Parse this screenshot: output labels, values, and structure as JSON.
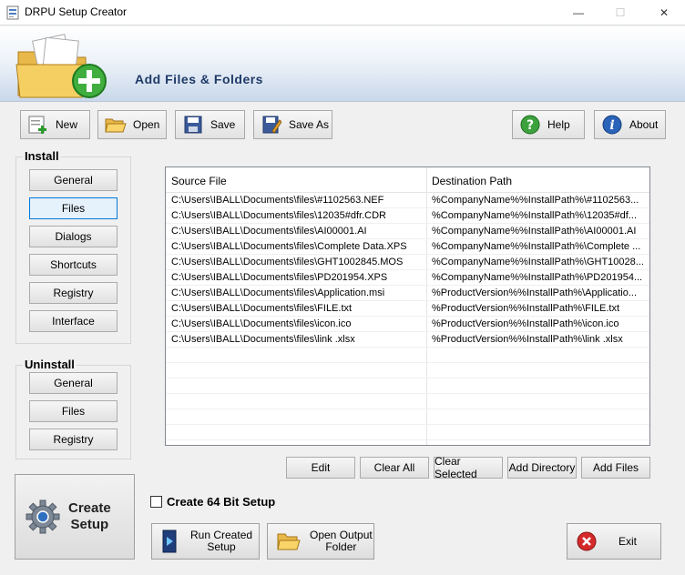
{
  "window": {
    "title": "DRPU Setup Creator"
  },
  "header": {
    "title": "Add Files & Folders"
  },
  "toolbar": {
    "new_label": "New",
    "open_label": "Open",
    "save_label": "Save",
    "save_as_label": "Save As",
    "help_label": "Help",
    "about_label": "About"
  },
  "install": {
    "title": "Install",
    "items": [
      "General",
      "Files",
      "Dialogs",
      "Shortcuts",
      "Registry",
      "Interface"
    ]
  },
  "uninstall": {
    "title": "Uninstall",
    "items": [
      "General",
      "Files",
      "Registry"
    ]
  },
  "table": {
    "headers": [
      "Source File",
      "Destination Path"
    ],
    "rows": [
      [
        "C:\\Users\\IBALL\\Documents\\files\\#1102563.NEF",
        "%CompanyName%%InstallPath%\\#1102563..."
      ],
      [
        "C:\\Users\\IBALL\\Documents\\files\\12035#dfr.CDR",
        "%CompanyName%%InstallPath%\\12035#df..."
      ],
      [
        "C:\\Users\\IBALL\\Documents\\files\\AI00001.AI",
        "%CompanyName%%InstallPath%\\AI00001.AI"
      ],
      [
        "C:\\Users\\IBALL\\Documents\\files\\Complete Data.XPS",
        "%CompanyName%%InstallPath%\\Complete ..."
      ],
      [
        "C:\\Users\\IBALL\\Documents\\files\\GHT1002845.MOS",
        "%CompanyName%%InstallPath%\\GHT10028..."
      ],
      [
        "C:\\Users\\IBALL\\Documents\\files\\PD201954.XPS",
        "%CompanyName%%InstallPath%\\PD201954..."
      ],
      [
        "C:\\Users\\IBALL\\Documents\\files\\Application.msi",
        "%ProductVersion%%InstallPath%\\Applicatio..."
      ],
      [
        "C:\\Users\\IBALL\\Documents\\files\\FILE.txt",
        "%ProductVersion%%InstallPath%\\FILE.txt"
      ],
      [
        "C:\\Users\\IBALL\\Documents\\files\\icon.ico",
        "%ProductVersion%%InstallPath%\\icon.ico"
      ],
      [
        "C:\\Users\\IBALL\\Documents\\files\\link .xlsx",
        "%ProductVersion%%InstallPath%\\link .xlsx"
      ]
    ]
  },
  "actions": {
    "edit": "Edit",
    "clear_all": "Clear All",
    "clear_selected": "Clear Selected",
    "add_directory": "Add Directory",
    "add_files": "Add Files"
  },
  "option": {
    "create_64bit": "Create 64 Bit Setup",
    "checked": false
  },
  "bottom": {
    "create_line1": "Create",
    "create_line2": "Setup",
    "run_line1": "Run Created",
    "run_line2": "Setup",
    "open_line1": "Open Output",
    "open_line2": "Folder",
    "exit": "Exit"
  },
  "colors": {
    "accent": "#0078d7",
    "header_text": "#1f3a68"
  }
}
